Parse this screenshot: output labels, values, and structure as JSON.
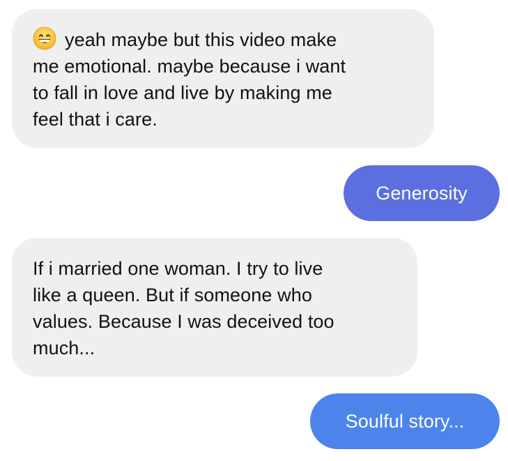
{
  "colors": {
    "incoming_bubble": "#efefef",
    "outgoing_bubble_1": "#5b6fe0",
    "outgoing_bubble_2": "#4c84ec",
    "text_dark": "#111111",
    "text_light": "#ffffff"
  },
  "messages": [
    {
      "direction": "incoming",
      "emoji": "grinning-face-icon",
      "lines": [
        "yeah maybe but this video make",
        "me emotional. maybe because i want",
        "to fall in love and live by making me",
        "feel that i care."
      ]
    },
    {
      "direction": "outgoing",
      "lines": [
        "Generosity"
      ]
    },
    {
      "direction": "incoming",
      "lines": [
        "If i married one woman. I try to live",
        "like a queen. But if someone who",
        "values. Because I was deceived too",
        "much..."
      ]
    },
    {
      "direction": "outgoing",
      "lines": [
        "Soulful story..."
      ]
    }
  ]
}
